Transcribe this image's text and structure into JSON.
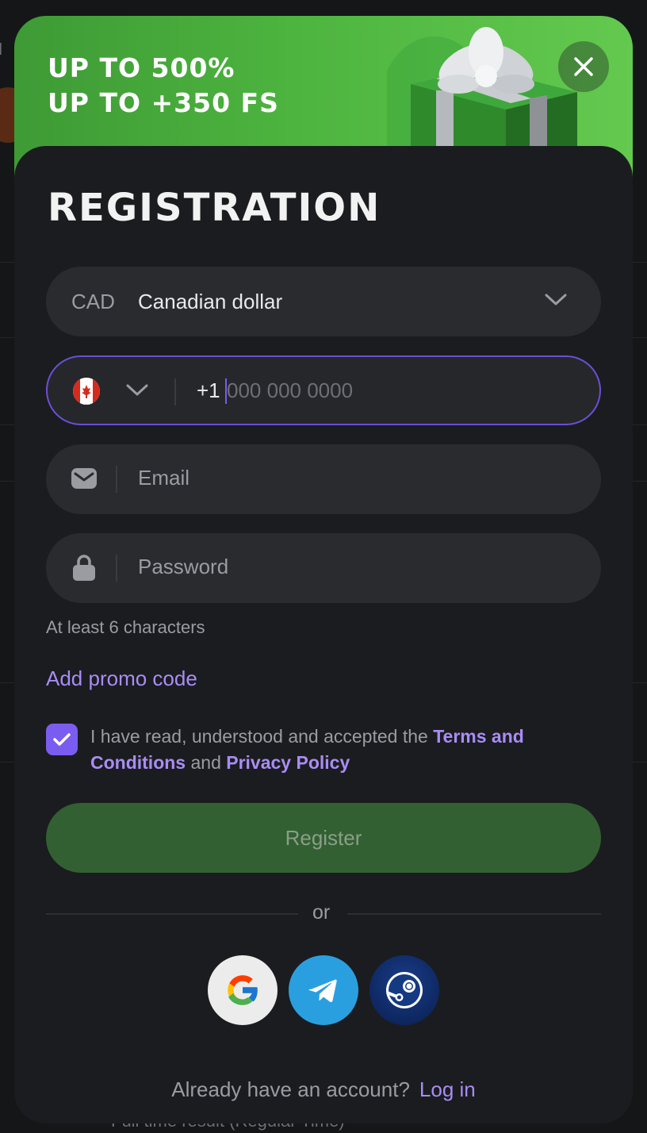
{
  "background": {
    "partial_text": "ll",
    "bottom_text": "Full time result (Regular Time)"
  },
  "banner": {
    "line1": "UP TO 500%",
    "line2": "UP TO +350 FS"
  },
  "title": "REGISTRATION",
  "currency": {
    "code": "CAD",
    "name": "Canadian dollar"
  },
  "phone": {
    "country": "Canada",
    "prefix": "+1",
    "placeholder": "000 000 0000"
  },
  "email": {
    "placeholder": "Email"
  },
  "password": {
    "placeholder": "Password",
    "hint": "At least 6 characters"
  },
  "promo_link": "Add promo code",
  "terms": {
    "checked": true,
    "prefix": "I have read, understood and accepted the ",
    "terms_link": "Terms and Conditions",
    "middle": " and ",
    "privacy_link": "Privacy Policy"
  },
  "register_label": "Register",
  "divider_label": "or",
  "social": [
    "google-icon",
    "telegram-icon",
    "steam-icon"
  ],
  "footer": {
    "question": "Already have an account?",
    "login_label": "Log in"
  },
  "colors": {
    "accent": "#7b5cf0",
    "link": "#a98cf5",
    "register_bg": "#336032",
    "banner_green": "#4db43f"
  }
}
